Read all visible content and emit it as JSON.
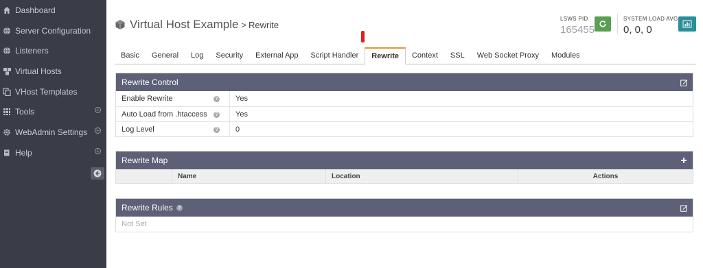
{
  "sidebar": {
    "items": [
      {
        "label": "Dashboard",
        "icon": "home-icon",
        "expandable": false
      },
      {
        "label": "Server Configuration",
        "icon": "globe-icon",
        "expandable": false
      },
      {
        "label": "Listeners",
        "icon": "globe-icon",
        "expandable": false
      },
      {
        "label": "Virtual Hosts",
        "icon": "cubes-icon",
        "expandable": false
      },
      {
        "label": "VHost Templates",
        "icon": "copy-icon",
        "expandable": false
      },
      {
        "label": "Tools",
        "icon": "grid-icon",
        "expandable": true
      },
      {
        "label": "WebAdmin Settings",
        "icon": "gear-icon",
        "expandable": true
      },
      {
        "label": "Help",
        "icon": "book-icon",
        "expandable": true
      }
    ]
  },
  "header": {
    "title": "Virtual Host Example",
    "separator": ">",
    "subtitle": "Rewrite",
    "pid_label": "LSWS PID",
    "pid_value": "165455",
    "load_label": "SYSTEM LOAD AVG",
    "load_value": "0, 0, 0"
  },
  "tabs": [
    "Basic",
    "General",
    "Log",
    "Security",
    "External App",
    "Script Handler",
    "Rewrite",
    "Context",
    "SSL",
    "Web Socket Proxy",
    "Modules"
  ],
  "active_tab": "Rewrite",
  "rewrite_control": {
    "title": "Rewrite Control",
    "rows": [
      {
        "label": "Enable Rewrite",
        "value": "Yes"
      },
      {
        "label": "Auto Load from .htaccess",
        "value": "Yes"
      },
      {
        "label": "Log Level",
        "value": "0"
      }
    ]
  },
  "rewrite_map": {
    "title": "Rewrite Map",
    "columns": [
      "Name",
      "Location",
      "Actions"
    ]
  },
  "rewrite_rules": {
    "title": "Rewrite Rules",
    "value": "Not Set"
  },
  "colors": {
    "sidebar_bg": "#3a3d47",
    "panel_header": "#5d6077",
    "active_tab_accent": "#e8952e",
    "restart_button": "#5a9f53",
    "stats_button": "#2a8e9a",
    "annotation_red": "#e02020"
  }
}
